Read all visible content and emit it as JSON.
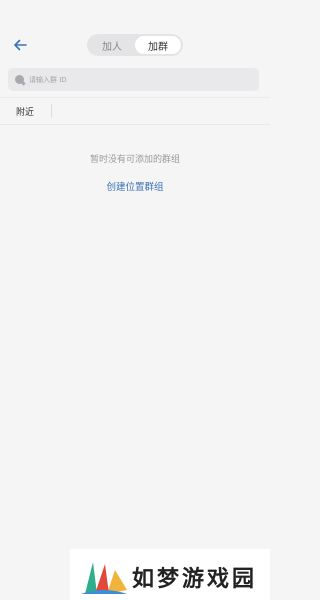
{
  "header": {
    "back_icon": "arrow-left-icon",
    "tabs": [
      {
        "label": "加人",
        "active": false
      },
      {
        "label": "加群",
        "active": true
      }
    ]
  },
  "search": {
    "icon": "search-icon",
    "placeholder": "请输入群 ID"
  },
  "filter": {
    "items": [
      {
        "label": "附近"
      }
    ]
  },
  "empty_state": {
    "message": "暂时没有可添加的群组",
    "action_label": "创建位置群组"
  },
  "watermark": {
    "text": "如梦游戏园"
  },
  "colors": {
    "accent": "#3c72b8",
    "background": "#f5f5f6"
  }
}
